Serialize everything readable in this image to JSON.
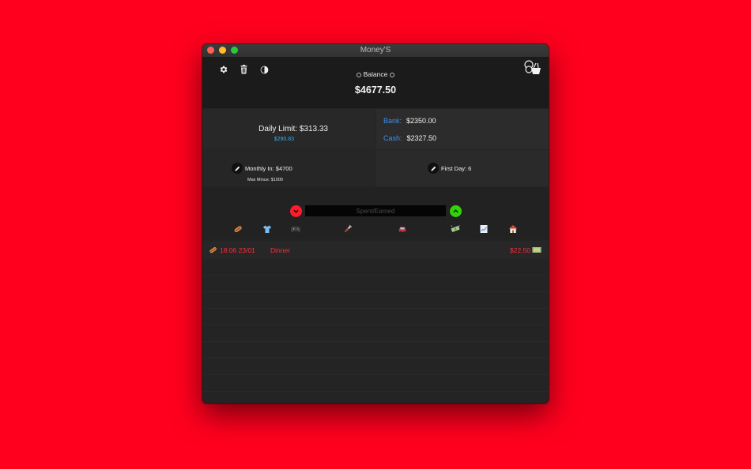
{
  "window": {
    "title": "Money'S"
  },
  "toolbar": {
    "settings_icon": "gear-icon",
    "delete_icon": "trash-icon",
    "theme_icon": "half-moon-icon",
    "shop_icon": "basket-icon"
  },
  "balance": {
    "label": "Balance",
    "value": "$4677.50"
  },
  "daily": {
    "label": "Daily Limit: $313.33",
    "remaining": "$290.83"
  },
  "accounts": {
    "bank_label": "Bank:",
    "bank_value": "$2350.00",
    "cash_label": "Cash:",
    "cash_value": "$2327.50"
  },
  "monthly": {
    "label": "Monthly In: $4700",
    "max_minus": "Max Minus: $1000"
  },
  "first_day": {
    "label": "First Day: 6"
  },
  "entry": {
    "placeholder": "Spent/Earned"
  },
  "categories": [
    "food",
    "clothing",
    "games",
    "health",
    "transport",
    "money",
    "bills",
    "home"
  ],
  "transactions": [
    {
      "time": "18:06 23/01",
      "description": "Dinner",
      "amount": "$22.50",
      "category": "food",
      "payment": "cash"
    }
  ],
  "colors": {
    "background": "#ff001e",
    "accent_blue": "#3d8ff0",
    "expense_red": "#ff2d3a",
    "income_green": "#34d10c"
  }
}
